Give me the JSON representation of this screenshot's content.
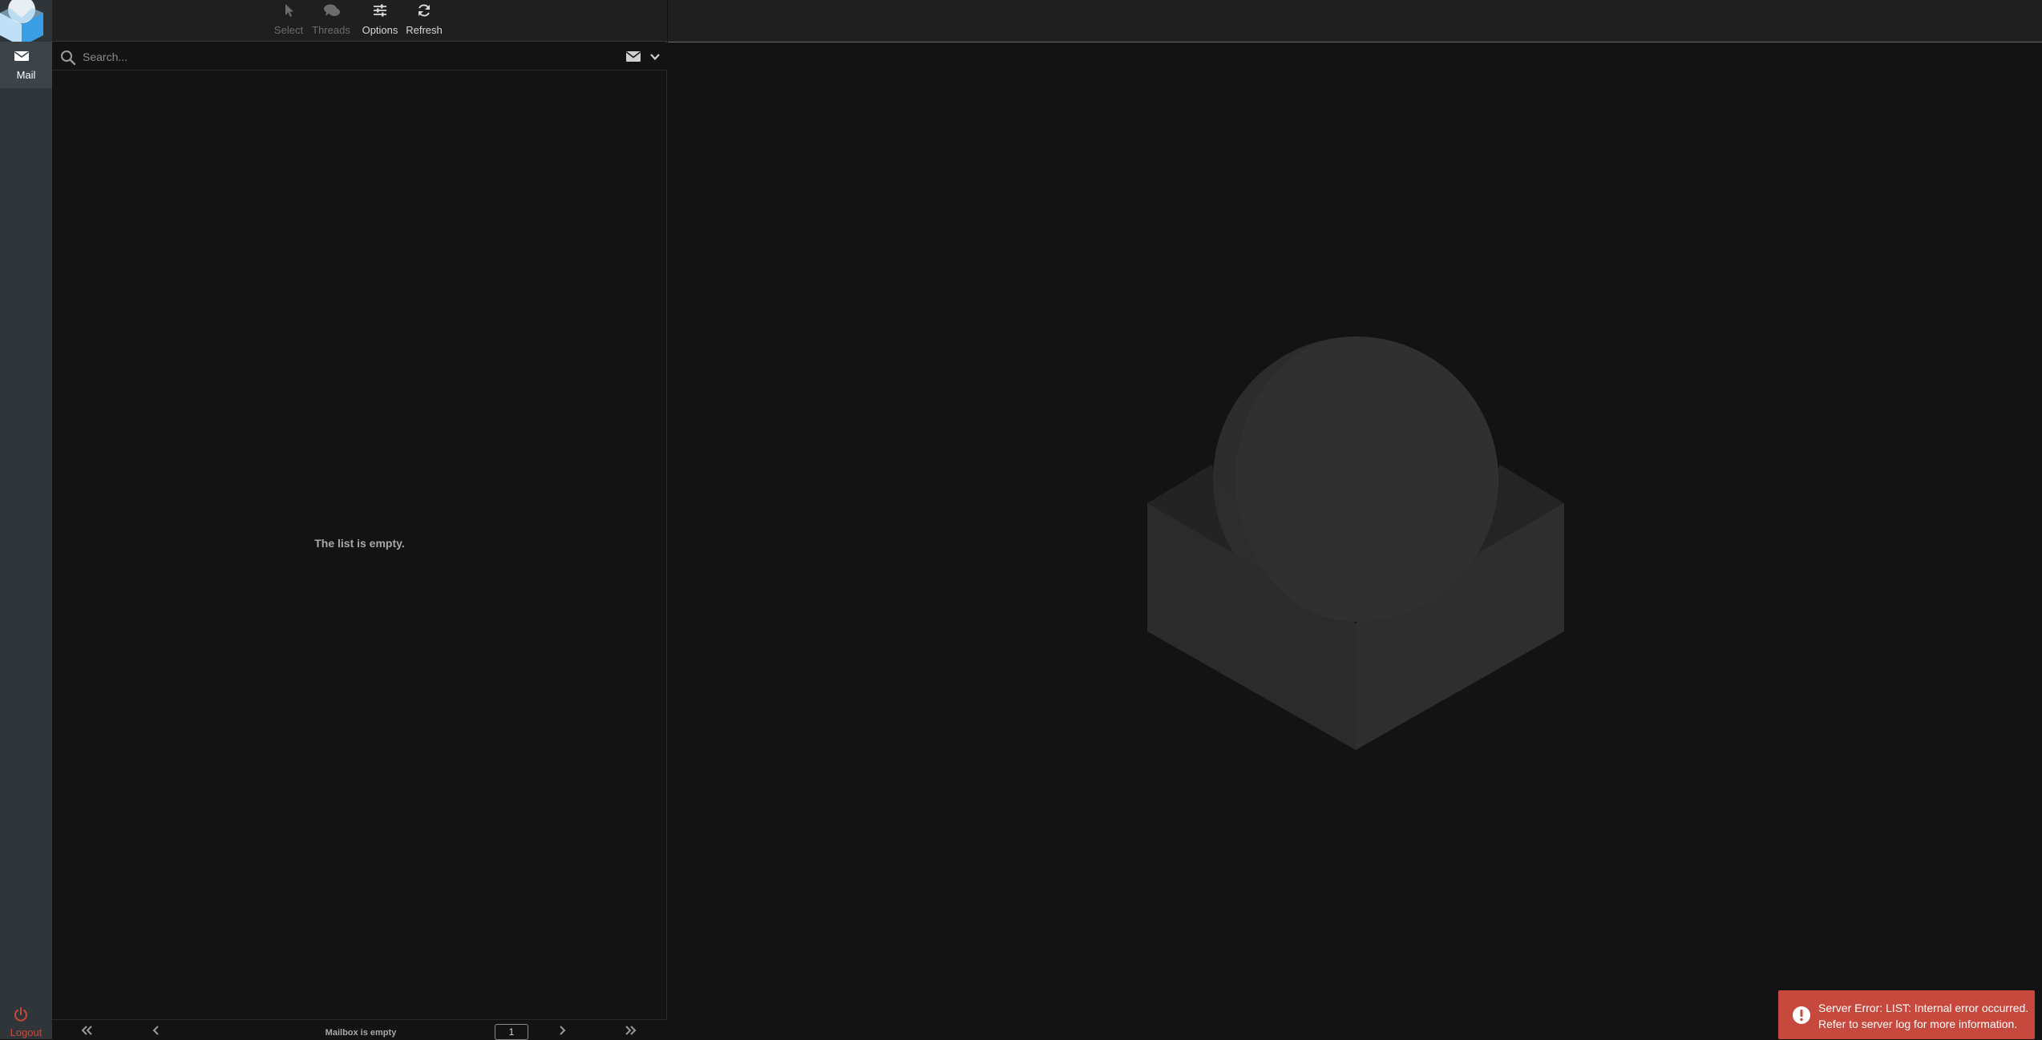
{
  "taskmenu": {
    "mail_label": "Mail",
    "logout_label": "Logout",
    "icons": {
      "mail": "envelope-icon",
      "logout": "power-icon"
    }
  },
  "toolbar": {
    "buttons": [
      {
        "label": "Select",
        "icon": "pointer-icon",
        "enabled": false
      },
      {
        "label": "Threads",
        "icon": "threads-icon",
        "enabled": false
      },
      {
        "label": "Options",
        "icon": "sliders-icon",
        "enabled": true
      },
      {
        "label": "Refresh",
        "icon": "refresh-icon",
        "enabled": true
      }
    ]
  },
  "search": {
    "placeholder": "Search...",
    "value": ""
  },
  "message_list": {
    "empty_text": "The list is empty."
  },
  "pager": {
    "status": "Mailbox is empty",
    "page": "1"
  },
  "toast": {
    "type": "error",
    "message_line1": "Server Error: LIST: Internal error occurred.",
    "message_line2": "Refer to server log for more information."
  },
  "colors": {
    "sidebar_bg": "#2f3539",
    "sidebar_active": "#3c444a",
    "background": "#131313",
    "toolbar_bg": "#1f1f1f",
    "error": "#c7483d",
    "logo_blue": "#37beff"
  }
}
